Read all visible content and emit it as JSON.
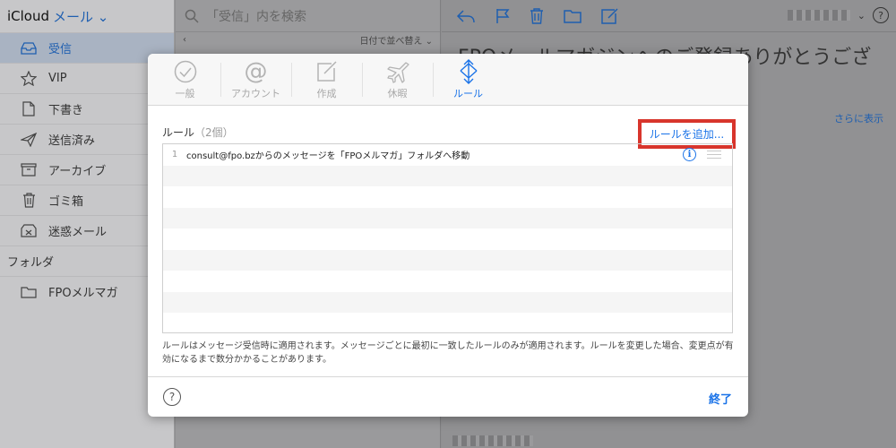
{
  "sidebar": {
    "brand": "iCloud",
    "app": "メール",
    "items": [
      {
        "label": "受信",
        "icon": "inbox-icon"
      },
      {
        "label": "VIP",
        "icon": "star-icon"
      },
      {
        "label": "下書き",
        "icon": "document-icon"
      },
      {
        "label": "送信済み",
        "icon": "paper-plane-icon"
      },
      {
        "label": "アーカイブ",
        "icon": "archive-box-icon"
      },
      {
        "label": "ゴミ箱",
        "icon": "trash-icon"
      },
      {
        "label": "迷惑メール",
        "icon": "junk-box-icon"
      }
    ],
    "folders_label": "フォルダ",
    "folders": [
      {
        "label": "FPOメルマガ",
        "icon": "folder-icon"
      }
    ]
  },
  "list": {
    "search_placeholder": "「受信」内を検索",
    "sort_label": "日付で並べ替え"
  },
  "message": {
    "subject": "FPOメールマガジンへのご登録ありがとうござ",
    "show_more": "さらに表示"
  },
  "modal": {
    "tabs": [
      {
        "label": "一般",
        "icon": "checkmark-circle-icon"
      },
      {
        "label": "アカウント",
        "icon": "at-sign-icon"
      },
      {
        "label": "作成",
        "icon": "compose-icon"
      },
      {
        "label": "休暇",
        "icon": "airplane-icon"
      },
      {
        "label": "ルール",
        "icon": "arrows-move-icon",
        "active": true
      }
    ],
    "rules_title": "ルール",
    "rules_count": "（2個）",
    "add_rule": "ルールを追加...",
    "rules": [
      {
        "num": "1",
        "text": "consult@fpo.bzからのメッセージを「FPOメルマガ」フォルダへ移動"
      }
    ],
    "note": "ルールはメッセージ受信時に適用されます。メッセージごとに最初に一致したルールのみが適用されます。ルールを変更した場合、変更点が有効になるまで数分かかることがあります。",
    "help": "?",
    "done": "終了"
  },
  "colors": {
    "accent": "#1a73e8",
    "highlight_border": "#d8352c"
  }
}
